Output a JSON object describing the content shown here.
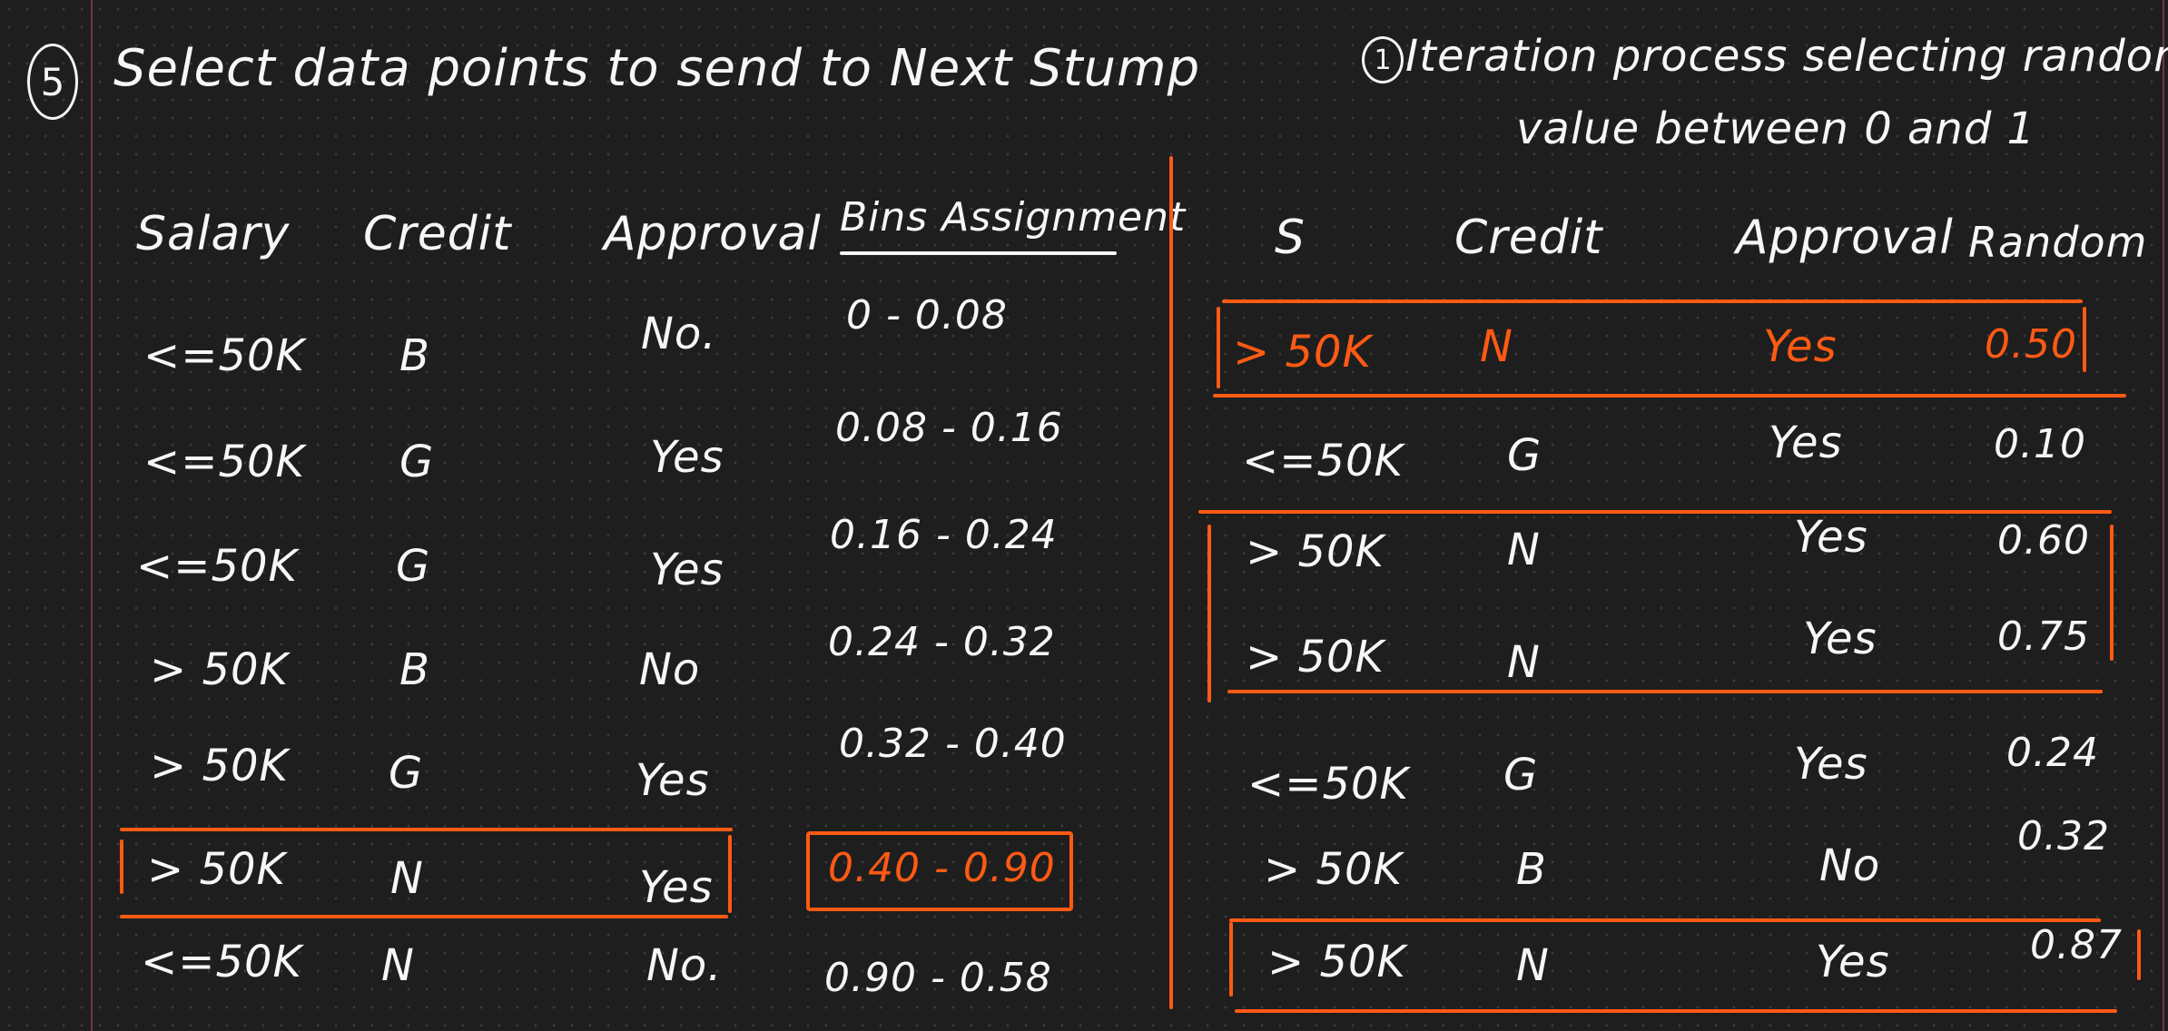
{
  "left": {
    "step_number": "5",
    "title": "Select data points to send to Next Stump",
    "headers": {
      "salary": "Salary",
      "credit": "Credit",
      "approval": "Approval",
      "bins": "Bins Assignment"
    },
    "rows": [
      {
        "salary": "<=50K",
        "credit": "B",
        "approval": "No.",
        "bin": "0 - 0.08"
      },
      {
        "salary": "<=50K",
        "credit": "G",
        "approval": "Yes",
        "bin": "0.08 - 0.16"
      },
      {
        "salary": "<=50K",
        "credit": "G",
        "approval": "Yes",
        "bin": "0.16 - 0.24"
      },
      {
        "salary": "> 50K",
        "credit": "B",
        "approval": "No",
        "bin": "0.24 - 0.32"
      },
      {
        "salary": "> 50K",
        "credit": "G",
        "approval": "Yes",
        "bin": "0.32 - 0.40"
      },
      {
        "salary": "> 50K",
        "credit": "N",
        "approval": "Yes",
        "bin": "0.40 - 0.90"
      },
      {
        "salary": "<=50K",
        "credit": "N",
        "approval": "No.",
        "bin": "0.90 - 0.58"
      }
    ]
  },
  "right": {
    "step_number": "1",
    "title_line1": "Iteration process selecting random",
    "title_line2": "value between 0 and 1",
    "headers": {
      "salary": "S",
      "credit": "Credit",
      "approval": "Approval",
      "random": "Random"
    },
    "rows": [
      {
        "salary": "> 50K",
        "credit": "N",
        "approval": "Yes",
        "random": "0.50"
      },
      {
        "salary": "<=50K",
        "credit": "G",
        "approval": "Yes",
        "random": "0.10"
      },
      {
        "salary": "> 50K",
        "credit": "N",
        "approval": "Yes",
        "random": "0.60"
      },
      {
        "salary": "> 50K",
        "credit": "N",
        "approval": "Yes",
        "random": "0.75"
      },
      {
        "salary": "<=50K",
        "credit": "G",
        "approval": "Yes",
        "random": "0.24"
      },
      {
        "salary": "> 50K",
        "credit": "B",
        "approval": "No",
        "random": "0.32"
      },
      {
        "salary": "> 50K",
        "credit": "N",
        "approval": "Yes",
        "random": "0.87"
      }
    ]
  },
  "colors": {
    "background": "#1e1e1e",
    "ink": "#f4f4f4",
    "highlight": "#ff5a14",
    "margin_line": "#8a3f5a"
  }
}
